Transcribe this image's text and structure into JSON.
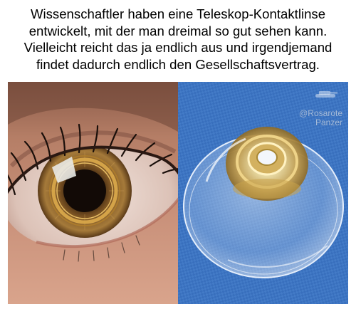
{
  "caption": {
    "lines": [
      "Wissenschaftler haben eine Teleskop-Kontaktlinse",
      "entwickelt, mit der man dreimal so gut sehen kann.",
      "Vielleicht reicht das ja endlich aus und irgendjemand",
      "findet dadurch endlich den Gesellschaftsvertrag."
    ]
  },
  "watermark": {
    "line1": "@Rosarote",
    "line2": "Panzer"
  },
  "images": {
    "left": {
      "subject": "eye-with-telescopic-contact-lens"
    },
    "right": {
      "subject": "telescopic-contact-lens-on-blue-fabric"
    }
  }
}
